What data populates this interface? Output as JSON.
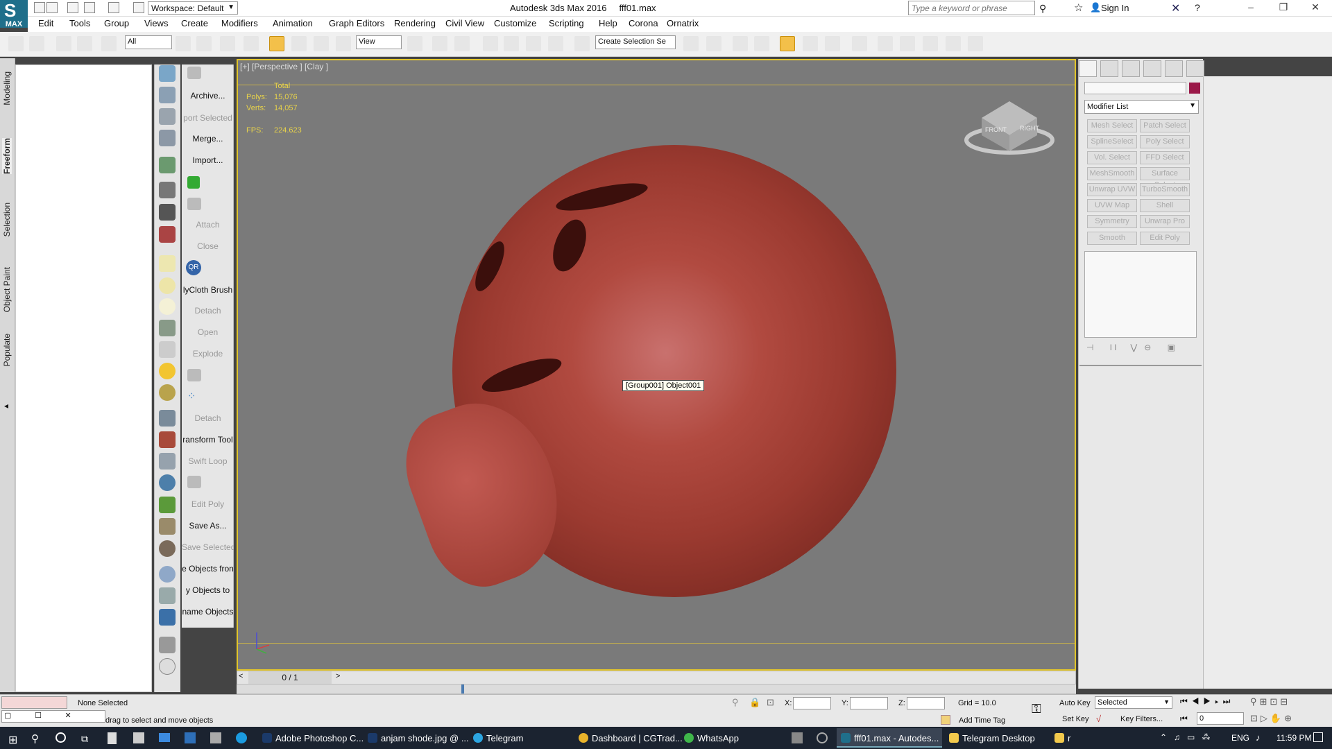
{
  "titlebar": {
    "app_logo": "MAX",
    "workspace": "Workspace: Default",
    "title": "Autodesk 3ds Max 2016",
    "file": "fff01.max",
    "search_placeholder": "Type a keyword or phrase",
    "sign_in": "Sign In"
  },
  "menu": [
    "Edit",
    "Tools",
    "Group",
    "Views",
    "Create",
    "Modifiers",
    "Animation",
    "Graph Editors",
    "Rendering",
    "Civil View",
    "Customize",
    "Scripting",
    "Help",
    "Corona",
    "Ornatrix"
  ],
  "toolbar": {
    "selection_filter": "All",
    "ref_coord": "View",
    "named_selection": "Create Selection Se"
  },
  "ribbon_tabs": [
    "Modeling",
    "Freeform",
    "Selection",
    "Object Paint",
    "Populate"
  ],
  "quick_panel": [
    "Archive...",
    "port Selected",
    "Merge...",
    "Import...",
    "",
    "",
    "Attach",
    "Close",
    "",
    "lyCloth Brush",
    "Detach",
    "Open",
    "Explode",
    "",
    "",
    "Detach",
    "ransform Tool",
    "Swift Loop",
    "",
    "Edit Poly",
    "Save As...",
    "Save Selected",
    "e Objects fron",
    "y Objects to",
    "name Objects"
  ],
  "quick_panel_disabled": [
    false,
    true,
    false,
    false,
    false,
    false,
    true,
    true,
    false,
    false,
    true,
    true,
    true,
    false,
    false,
    true,
    false,
    true,
    false,
    true,
    false,
    true,
    false,
    false,
    false
  ],
  "viewport": {
    "label": "[+] [Perspective ] [Clay ]",
    "stats_header": "Total",
    "polys_label": "Polys:",
    "polys": "15,076",
    "verts_label": "Verts:",
    "verts": "14,057",
    "fps_label": "FPS:",
    "fps": "224.623",
    "tooltip": "[Group001] Object001",
    "viewcube_front": "FRONT",
    "viewcube_right": "RIGHT"
  },
  "command_panel": {
    "modifier_list": "Modifier List",
    "modifiers": [
      "Mesh Select",
      "Patch Select",
      "SplineSelect",
      "Poly Select",
      "Vol. Select",
      "FFD Select",
      "MeshSmooth",
      "Surface Select",
      "Unwrap UVW",
      "TurboSmooth",
      "UVW Map",
      "Shell",
      "Symmetry",
      "Unwrap Pro",
      "Smooth",
      "Edit Poly"
    ],
    "color": "#9a1848"
  },
  "timeline": {
    "frame": "0 / 1"
  },
  "status": {
    "selection": "None Selected",
    "prompt": "drag to select and move objects",
    "x_label": "X:",
    "y_label": "Y:",
    "z_label": "Z:",
    "grid": "Grid = 10.0",
    "add_time_tag": "Add Time Tag",
    "auto_key": "Auto Key",
    "set_key": "Set Key",
    "selected": "Selected",
    "key_filters": "Key Filters...",
    "frame_value": "0"
  },
  "taskbar": {
    "items": [
      "Adobe Photoshop C...",
      "anjam shode.jpg @ ...",
      "Telegram",
      "Dashboard | CGTrad...",
      "WhatsApp",
      "fff01.max - Autodes...",
      "Telegram Desktop",
      "r"
    ],
    "lang": "ENG",
    "clock": "11:59 PM"
  }
}
